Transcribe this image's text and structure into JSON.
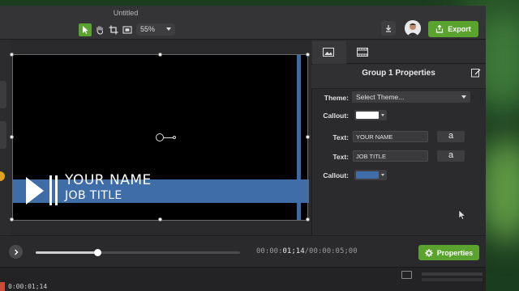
{
  "window": {
    "title": "Untitled"
  },
  "toolbar": {
    "zoom": "55%",
    "export_label": "Export",
    "tools": [
      "pointer-tool",
      "hand-tool",
      "crop-tool",
      "pan-zoom-tool"
    ]
  },
  "canvas": {
    "lower_third": {
      "name": "YOUR NAME",
      "job_title": "JOB TITLE"
    }
  },
  "playback": {
    "timecode_prefix": "00:00:",
    "timecode_current": "01;14",
    "timecode_total": "/00:00:05;00",
    "progress": 0.3,
    "properties_label": "Properties"
  },
  "timeline": {
    "current_time": "0:00:01;14"
  },
  "panel": {
    "title": "Group 1 Properties",
    "theme_label": "Theme:",
    "theme_value": "Select Theme...",
    "callout1_label": "Callout:",
    "callout1_color": "#ffffff",
    "text1_label": "Text:",
    "text1_value": "YOUR NAME",
    "text2_label": "Text:",
    "text2_value": "JOB TITLE",
    "font_button": "a",
    "callout2_label": "Callout:",
    "callout2_color": "#3f6da8"
  },
  "colors": {
    "accent_green": "#5aa32e",
    "callout_blue": "#3f6da8"
  }
}
